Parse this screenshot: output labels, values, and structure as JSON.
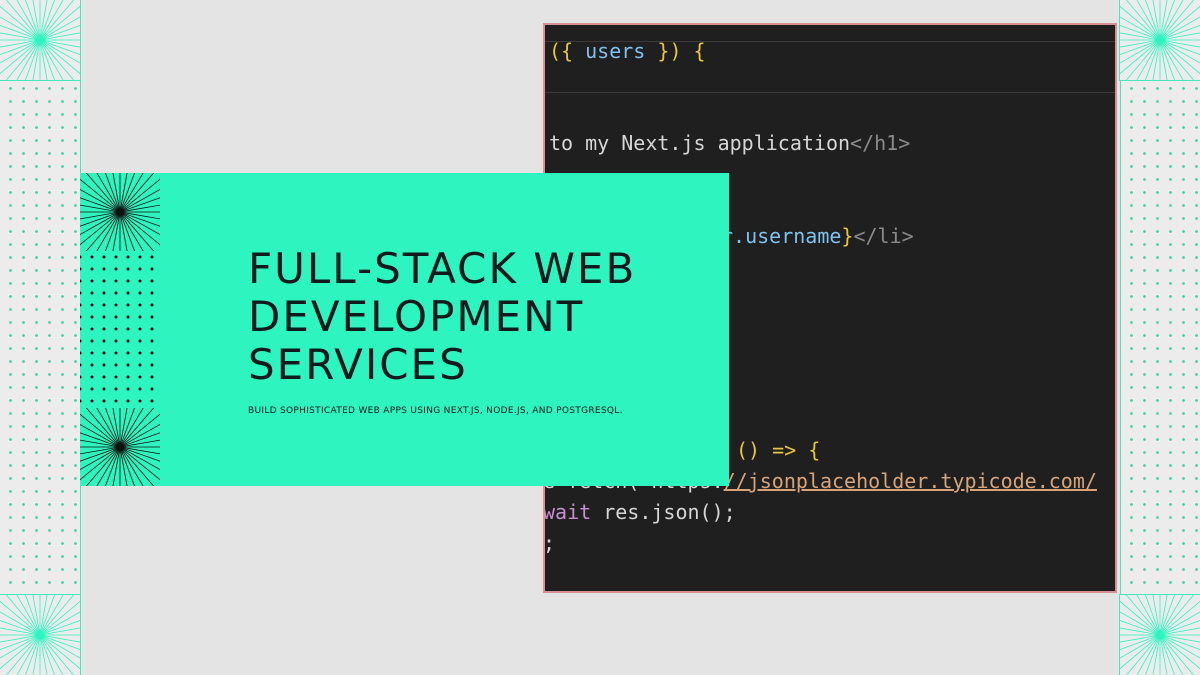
{
  "banner": {
    "title_line1": "FULL-STACK WEB",
    "title_line2": "DEVELOPMENT",
    "title_line3": "SERVICES",
    "subtitle": "BUILD SOPHISTICATED WEB APPS USING NEXT.JS, NODE.JS, AND POSTGRESQL."
  },
  "code": {
    "line1_open": "({",
    "line1_var": "users",
    "line1_close": "}) {",
    "line2_text": "to my Next.js application",
    "line2_tag": "</h1>",
    "line3_var": "r.username",
    "line3_brace": "}",
    "line3_tag": "</li>",
    "line4_arrow": "() => {",
    "line5_prefix": "e fetch(`https:",
    "line5_url": "//jsonplaceholder.typicode.com/",
    "line6_kw": "wait",
    "line6_rest": " res.json();",
    "line7": ";"
  },
  "colors": {
    "accent": "#2ef5c0",
    "background": "#e4e4e5",
    "editor_bg": "#1f1f1f",
    "editor_border": "#d78f96",
    "title_text": "#111a1c"
  },
  "icons": {
    "corner": "sunburst-icon"
  }
}
